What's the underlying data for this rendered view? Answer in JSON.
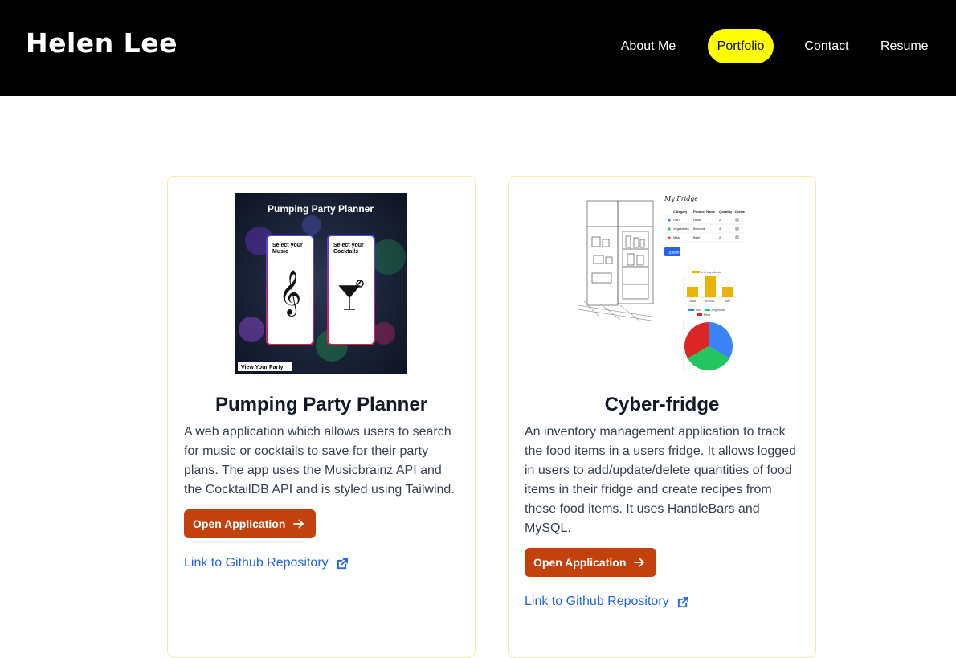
{
  "header": {
    "brand": "Helen Lee",
    "nav": [
      {
        "label": "About Me",
        "active": false
      },
      {
        "label": "Portfolio",
        "active": true
      },
      {
        "label": "Contact",
        "active": false
      },
      {
        "label": "Resume",
        "active": false
      }
    ]
  },
  "projects": [
    {
      "title": "Pumping Party Planner",
      "description": "A web application which allows users to search for music or cocktails to save for their party plans. The app uses the Musicbrainz API and the CocktailDB API and is styled using Tailwind.",
      "open_label": "Open Application",
      "repo_label": "Link to Github Repository",
      "thumbnail": {
        "heading": "Pumping Party Planner",
        "card_music": "Select your Music",
        "card_cocktails": "Select your Cocktails",
        "button": "View Your Party"
      }
    },
    {
      "title": "Cyber-fridge",
      "description": "An inventory management application to track the food items in a users fridge. It allows logged in users to add/update/delete quantities of food items in their fridge and create recipes from these food items. It uses HandleBars and MySQL.",
      "open_label": "Open Application",
      "repo_label": "Link to Github Repository",
      "thumbnail": {
        "heading": "My Fridge",
        "columns": [
          "Category",
          "Product Name",
          "Quantity",
          "Delete"
        ],
        "rows": [
          [
            "Fish",
            "Hake",
            "2"
          ],
          [
            "Vegetables",
            "Broccoli",
            "4"
          ],
          [
            "Meat",
            "Beef",
            "2"
          ]
        ],
        "update": "Update",
        "bar_legend": "# of ingredients",
        "bar_labels": [
          "Hake",
          "Broccoli",
          "Beef"
        ],
        "pie_legend": [
          "Fish",
          "Vegetables",
          "Meat"
        ]
      }
    }
  ],
  "colors": {
    "header_bg": "#000000",
    "active_nav": "#ffff00",
    "button": "#c2410c",
    "link": "#2563eb",
    "card_border": "#fbeaa6"
  }
}
